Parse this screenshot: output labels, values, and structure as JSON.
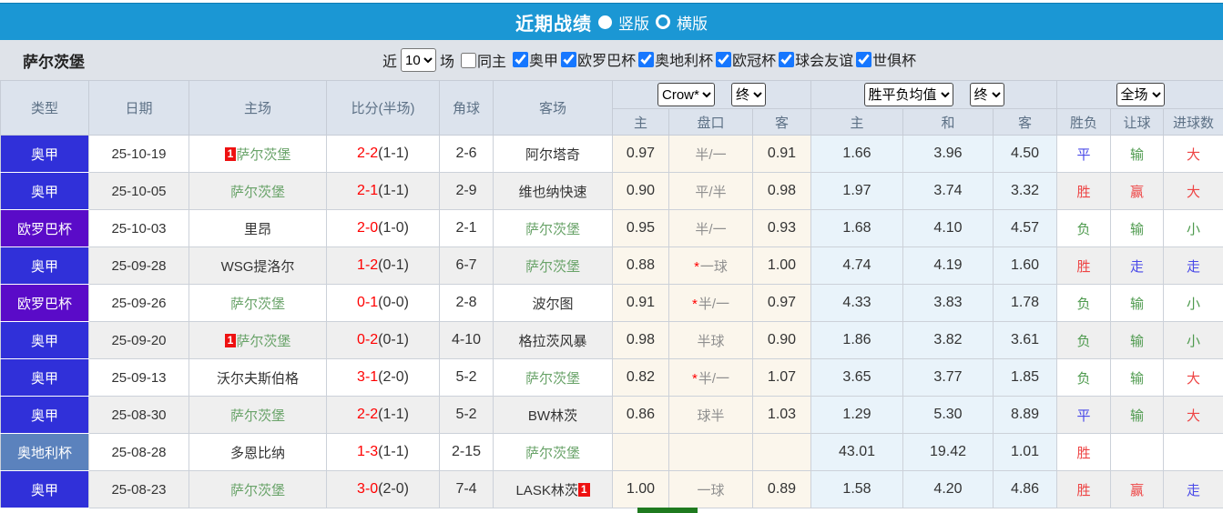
{
  "title_bar": {
    "title": "近期战绩",
    "vertical_label": "竖版",
    "horizontal_label": "横版",
    "vertical_selected": true
  },
  "filter_bar": {
    "team_name": "萨尔茨堡",
    "recent_label": "近",
    "match_count": "10",
    "matches_label": "场",
    "same_home_label": "同主",
    "same_home_checked": false,
    "leagues": [
      {
        "label": "奥甲",
        "checked": true
      },
      {
        "label": "欧罗巴杯",
        "checked": true
      },
      {
        "label": "奥地利杯",
        "checked": true
      },
      {
        "label": "欧冠杯",
        "checked": true
      },
      {
        "label": "球会友谊",
        "checked": true
      },
      {
        "label": "世俱杯",
        "checked": true
      }
    ]
  },
  "table": {
    "selects": {
      "bookmaker": "Crow*",
      "asian_time": "终",
      "euro_type": "胜平负均值",
      "euro_time": "终",
      "scope": "全场"
    },
    "headers": {
      "type": "类型",
      "date": "日期",
      "home": "主场",
      "score": "比分(半场)",
      "corner": "角球",
      "away": "客场",
      "ah_home": "主",
      "ah_line": "盘口",
      "ah_away": "客",
      "eu_home": "主",
      "eu_draw": "和",
      "eu_away": "客",
      "result": "胜负",
      "handicap_result": "让球",
      "goals_result": "进球数"
    },
    "rows": [
      {
        "league": "奥甲",
        "date": "25-10-19",
        "home_badge": "1",
        "home": "萨尔茨堡",
        "home_green": true,
        "score_ft": "2-2",
        "score_ht": "(1-1)",
        "corner": "2-6",
        "away": "阿尔塔奇",
        "away_badge": "",
        "away_green": false,
        "ah_home": "0.97",
        "ah_star": "",
        "ah_line": "半/一",
        "ah_away": "0.91",
        "eu_home": "1.66",
        "eu_draw": "3.96",
        "eu_away": "4.50",
        "wl": "平",
        "wl_c": "draw",
        "hc": "输",
        "hc_c": "loss",
        "ou": "大",
        "ou_c": "win"
      },
      {
        "league": "奥甲",
        "date": "25-10-05",
        "home_badge": "",
        "home": "萨尔茨堡",
        "home_green": true,
        "score_ft": "2-1",
        "score_ht": "(1-1)",
        "corner": "2-9",
        "away": "维也纳快速",
        "away_badge": "",
        "away_green": false,
        "ah_home": "0.90",
        "ah_star": "",
        "ah_line": "平/半",
        "ah_away": "0.98",
        "eu_home": "1.97",
        "eu_draw": "3.74",
        "eu_away": "3.32",
        "wl": "胜",
        "wl_c": "win",
        "hc": "赢",
        "hc_c": "win",
        "ou": "大",
        "ou_c": "win"
      },
      {
        "league": "欧罗巴杯",
        "date": "25-10-03",
        "home_badge": "",
        "home": "里昂",
        "home_green": false,
        "score_ft": "2-0",
        "score_ht": "(1-0)",
        "corner": "2-1",
        "away": "萨尔茨堡",
        "away_badge": "",
        "away_green": true,
        "ah_home": "0.95",
        "ah_star": "",
        "ah_line": "半/一",
        "ah_away": "0.93",
        "eu_home": "1.68",
        "eu_draw": "4.10",
        "eu_away": "4.57",
        "wl": "负",
        "wl_c": "loss",
        "hc": "输",
        "hc_c": "loss",
        "ou": "小",
        "ou_c": "loss"
      },
      {
        "league": "奥甲",
        "date": "25-09-28",
        "home_badge": "",
        "home": "WSG提洛尔",
        "home_green": false,
        "score_ft": "1-2",
        "score_ht": "(0-1)",
        "corner": "6-7",
        "away": "萨尔茨堡",
        "away_badge": "",
        "away_green": true,
        "ah_home": "0.88",
        "ah_star": "*",
        "ah_line": "一球",
        "ah_away": "1.00",
        "eu_home": "4.74",
        "eu_draw": "4.19",
        "eu_away": "1.60",
        "wl": "胜",
        "wl_c": "win",
        "hc": "走",
        "hc_c": "draw",
        "ou": "走",
        "ou_c": "draw"
      },
      {
        "league": "欧罗巴杯",
        "date": "25-09-26",
        "home_badge": "",
        "home": "萨尔茨堡",
        "home_green": true,
        "score_ft": "0-1",
        "score_ht": "(0-0)",
        "corner": "2-8",
        "away": "波尔图",
        "away_badge": "",
        "away_green": false,
        "ah_home": "0.91",
        "ah_star": "*",
        "ah_line": "半/一",
        "ah_away": "0.97",
        "eu_home": "4.33",
        "eu_draw": "3.83",
        "eu_away": "1.78",
        "wl": "负",
        "wl_c": "loss",
        "hc": "输",
        "hc_c": "loss",
        "ou": "小",
        "ou_c": "loss"
      },
      {
        "league": "奥甲",
        "date": "25-09-20",
        "home_badge": "1",
        "home": "萨尔茨堡",
        "home_green": true,
        "score_ft": "0-2",
        "score_ht": "(0-1)",
        "corner": "4-10",
        "away": "格拉茨风暴",
        "away_badge": "",
        "away_green": false,
        "ah_home": "0.98",
        "ah_star": "",
        "ah_line": "半球",
        "ah_away": "0.90",
        "eu_home": "1.86",
        "eu_draw": "3.82",
        "eu_away": "3.61",
        "wl": "负",
        "wl_c": "loss",
        "hc": "输",
        "hc_c": "loss",
        "ou": "小",
        "ou_c": "loss"
      },
      {
        "league": "奥甲",
        "date": "25-09-13",
        "home_badge": "",
        "home": "沃尔夫斯伯格",
        "home_green": false,
        "score_ft": "3-1",
        "score_ht": "(2-0)",
        "corner": "5-2",
        "away": "萨尔茨堡",
        "away_badge": "",
        "away_green": true,
        "ah_home": "0.82",
        "ah_star": "*",
        "ah_line": "半/一",
        "ah_away": "1.07",
        "eu_home": "3.65",
        "eu_draw": "3.77",
        "eu_away": "1.85",
        "wl": "负",
        "wl_c": "loss",
        "hc": "输",
        "hc_c": "loss",
        "ou": "大",
        "ou_c": "win"
      },
      {
        "league": "奥甲",
        "date": "25-08-30",
        "home_badge": "",
        "home": "萨尔茨堡",
        "home_green": true,
        "score_ft": "2-2",
        "score_ht": "(1-1)",
        "corner": "5-2",
        "away": "BW林茨",
        "away_badge": "",
        "away_green": false,
        "ah_home": "0.86",
        "ah_star": "",
        "ah_line": "球半",
        "ah_away": "1.03",
        "eu_home": "1.29",
        "eu_draw": "5.30",
        "eu_away": "8.89",
        "wl": "平",
        "wl_c": "draw",
        "hc": "输",
        "hc_c": "loss",
        "ou": "大",
        "ou_c": "win"
      },
      {
        "league": "奥地利杯",
        "date": "25-08-28",
        "home_badge": "",
        "home": "多恩比纳",
        "home_green": false,
        "score_ft": "1-3",
        "score_ht": "(1-1)",
        "corner": "2-15",
        "away": "萨尔茨堡",
        "away_badge": "",
        "away_green": true,
        "ah_home": "",
        "ah_star": "",
        "ah_line": "",
        "ah_away": "",
        "eu_home": "43.01",
        "eu_draw": "19.42",
        "eu_away": "1.01",
        "wl": "胜",
        "wl_c": "win",
        "hc": "",
        "hc_c": "",
        "ou": "",
        "ou_c": ""
      },
      {
        "league": "奥甲",
        "date": "25-08-23",
        "home_badge": "",
        "home": "萨尔茨堡",
        "home_green": true,
        "score_ft": "3-0",
        "score_ht": "(2-0)",
        "corner": "7-4",
        "away": "LASK林茨",
        "away_badge": "1",
        "away_green": false,
        "ah_home": "1.00",
        "ah_star": "",
        "ah_line": "一球",
        "ah_away": "0.89",
        "eu_home": "1.58",
        "eu_draw": "4.20",
        "eu_away": "4.86",
        "wl": "胜",
        "wl_c": "win",
        "hc": "赢",
        "hc_c": "win",
        "ou": "走",
        "ou_c": "draw"
      }
    ]
  },
  "colors": {
    "top_bar": "#1b97d4",
    "league": {
      "奥甲": "#3030d9",
      "欧罗巴杯": "#5a0bc8",
      "奥地利杯": "#5b82bd"
    },
    "result": {
      "win": "#ee4444",
      "draw": "#4a4ae8",
      "loss": "#4e9a4e"
    },
    "team_green": "#69a369",
    "score_red": "#ff0000",
    "badge_red": "#ee1111",
    "bottom_bar_green": "#1f7a1f"
  }
}
